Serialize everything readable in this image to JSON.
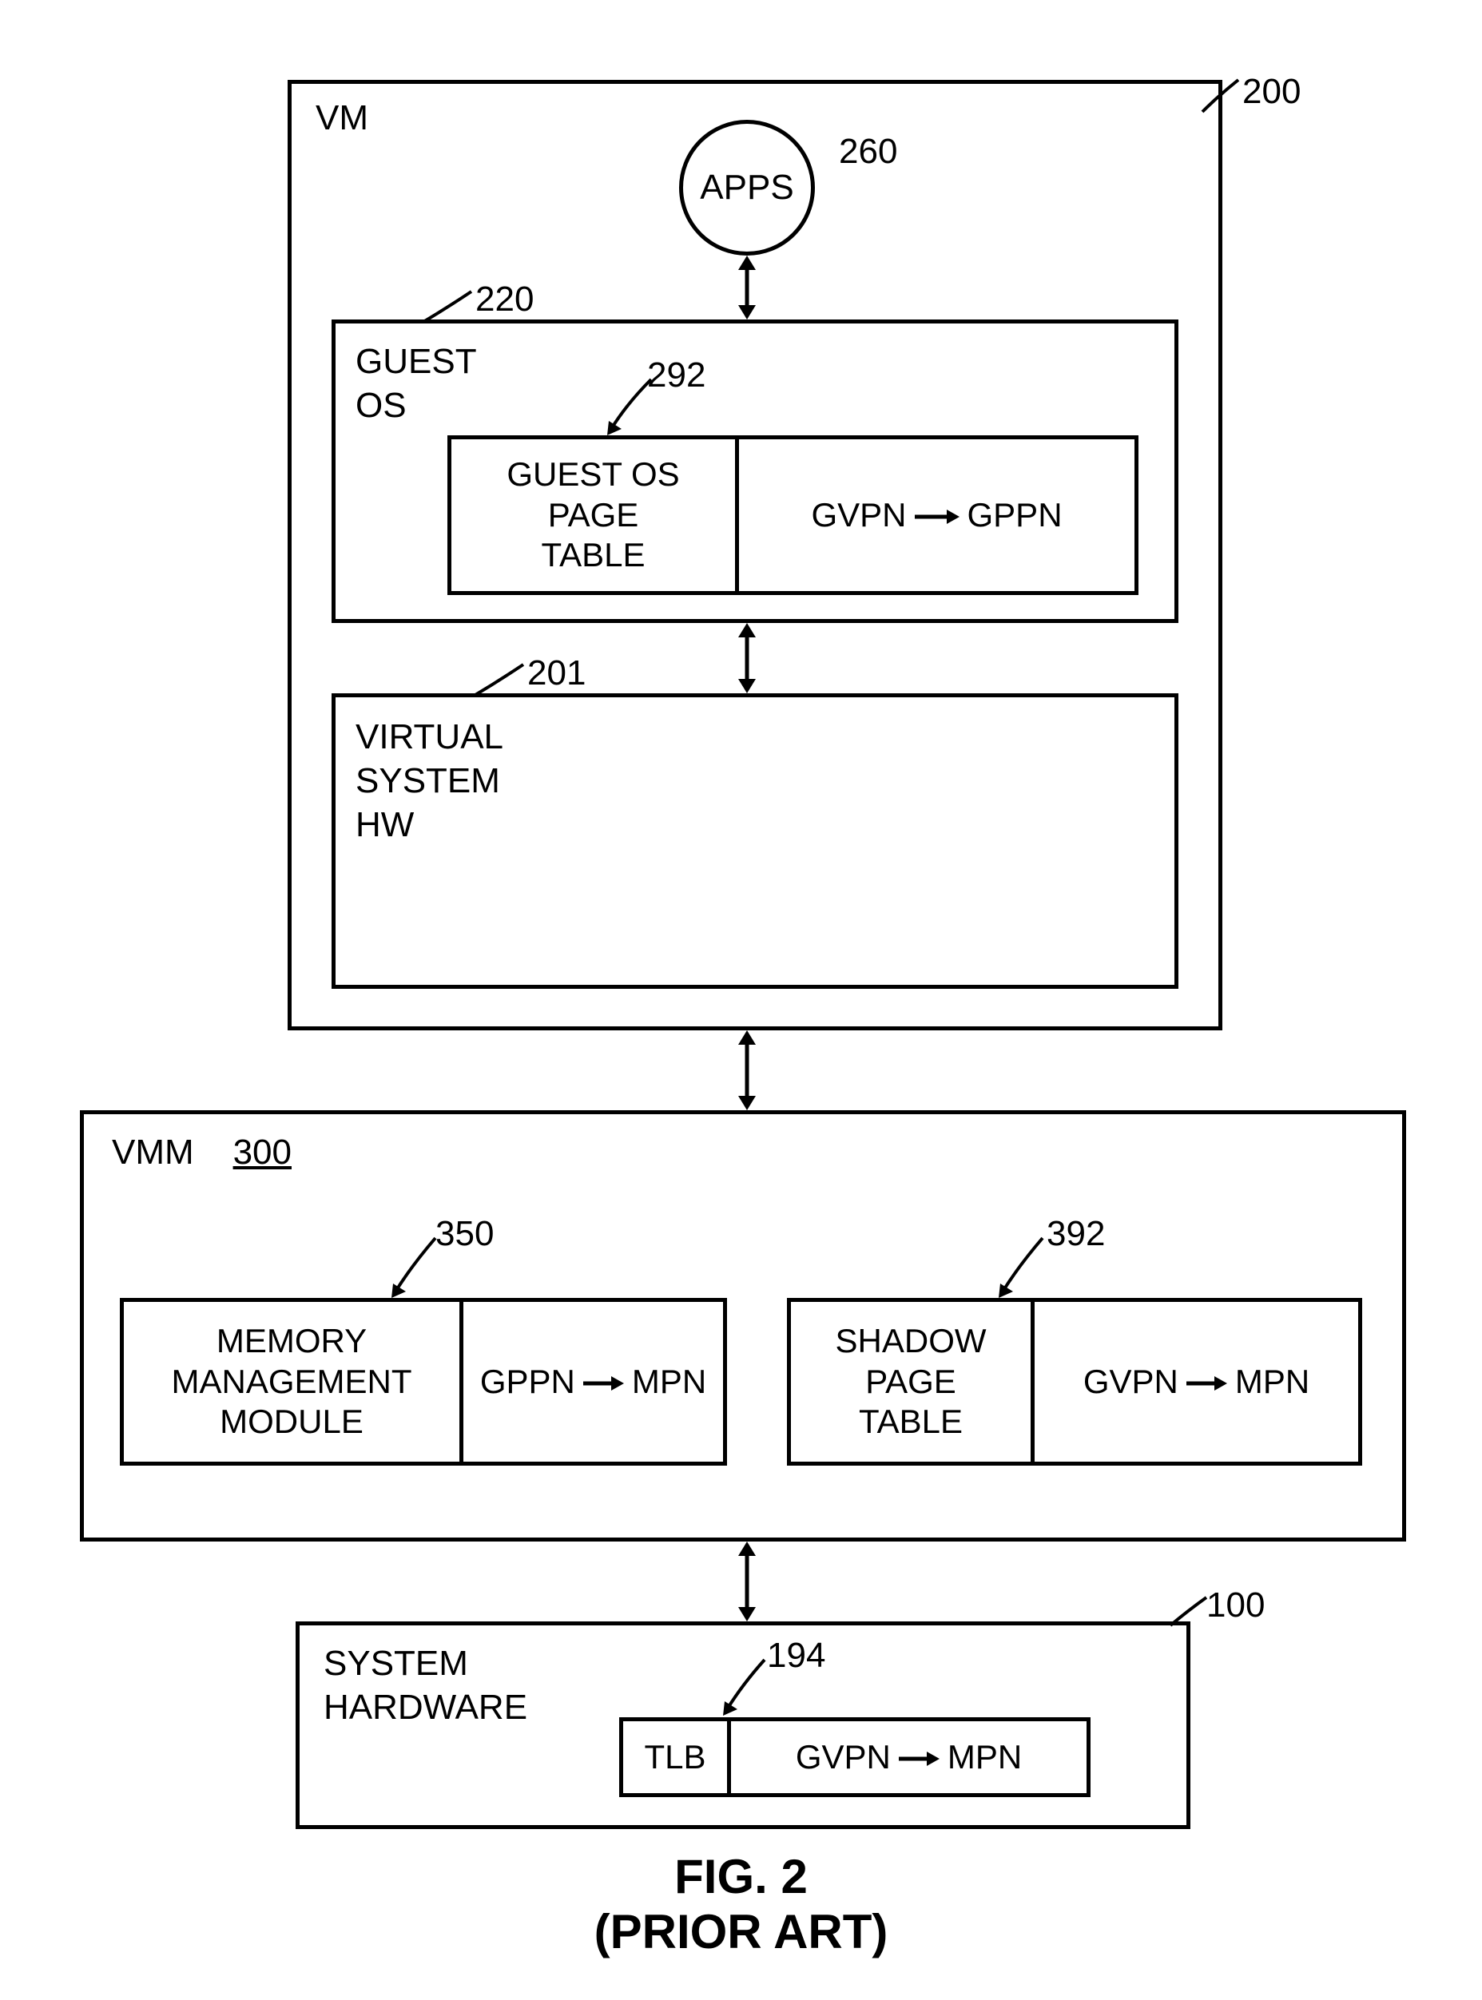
{
  "refs": {
    "vm": "200",
    "apps": "260",
    "guestos": "220",
    "guestos_pt": "292",
    "vhw": "201",
    "vmm": "300",
    "mmm": "350",
    "spt": "392",
    "syshw": "100",
    "tlb": "194"
  },
  "labels": {
    "vm": "VM",
    "apps": "APPS",
    "guestos": "GUEST\nOS",
    "guestos_pt_left": "GUEST OS\nPAGE\nTABLE",
    "guestos_pt_map_a": "GVPN",
    "guestos_pt_map_b": "GPPN",
    "vhw": "VIRTUAL\nSYSTEM\nHW",
    "vmm": "VMM",
    "mmm_left": "MEMORY\nMANAGEMENT\nMODULE",
    "mmm_map_a": "GPPN",
    "mmm_map_b": "MPN",
    "spt_left": "SHADOW\nPAGE\nTABLE",
    "spt_map_a": "GVPN",
    "spt_map_b": "MPN",
    "syshw": "SYSTEM\nHARDWARE",
    "tlb_left": "TLB",
    "tlb_map_a": "GVPN",
    "tlb_map_b": "MPN",
    "fig": "FIG. 2",
    "prior": "(PRIOR ART)"
  }
}
